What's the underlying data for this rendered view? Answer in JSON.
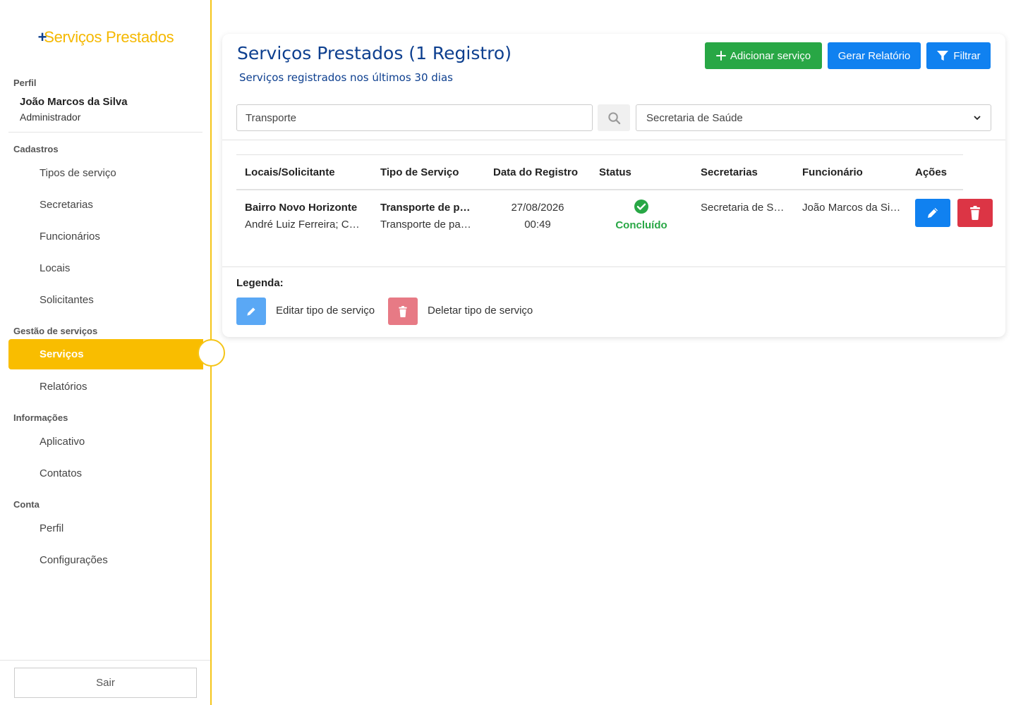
{
  "sidebar": {
    "logo_plus": "+",
    "logo_text": "Serviços Prestados",
    "profile_title": "Perfil",
    "profile_name": "João Marcos da Silva",
    "profile_role": "Administrador",
    "sections": {
      "cadastros": "Cadastros",
      "gestao": "Gestão de serviços",
      "informacoes": "Informações",
      "conta": "Conta"
    },
    "items": {
      "tipos": "Tipos de serviço",
      "secretarias": "Secretarias",
      "funcionarios": "Funcionários",
      "locais": "Locais",
      "solicitantes": "Solicitantes",
      "servicos": "Serviços",
      "relatorios": "Relatórios",
      "aplicativo": "Aplicativo",
      "contatos": "Contatos",
      "perfil": "Perfil",
      "configuracoes": "Configurações"
    },
    "logout_label": "Sair",
    "accent_color": "#f9bd00"
  },
  "header": {
    "title": "Serviços Prestados (1 Registro)",
    "subtitle": "Serviços registrados nos últimos 30 dias",
    "add_label": "Adicionar serviço",
    "report_label": "Gerar Relatório",
    "filter_label": "Filtrar"
  },
  "filters": {
    "search_value": "Transporte",
    "secretaria_selected": "Secretaria de Saúde"
  },
  "table": {
    "headers": {
      "locais": "Locais/Solicitante",
      "tipo": "Tipo de Serviço",
      "data": "Data do Registro",
      "status": "Status",
      "secretarias": "Secretarias",
      "funcionario": "Funcionário",
      "acoes": "Ações"
    },
    "rows": [
      {
        "local": "Bairro Novo Horizonte",
        "solicitante": "André Luiz Ferreira; Carlos",
        "tipo_bold": "Transporte de pacientes",
        "tipo": "Transporte de pacientes",
        "date": "27/08/2026",
        "time": "00:49",
        "status": "Concluído",
        "secretaria": "Secretaria de Saúde",
        "funcionario": "João Marcos da Silva"
      }
    ]
  },
  "legend": {
    "title": "Legenda:",
    "edit_label": "Editar tipo de serviço",
    "delete_label": "Deletar tipo de serviço"
  }
}
